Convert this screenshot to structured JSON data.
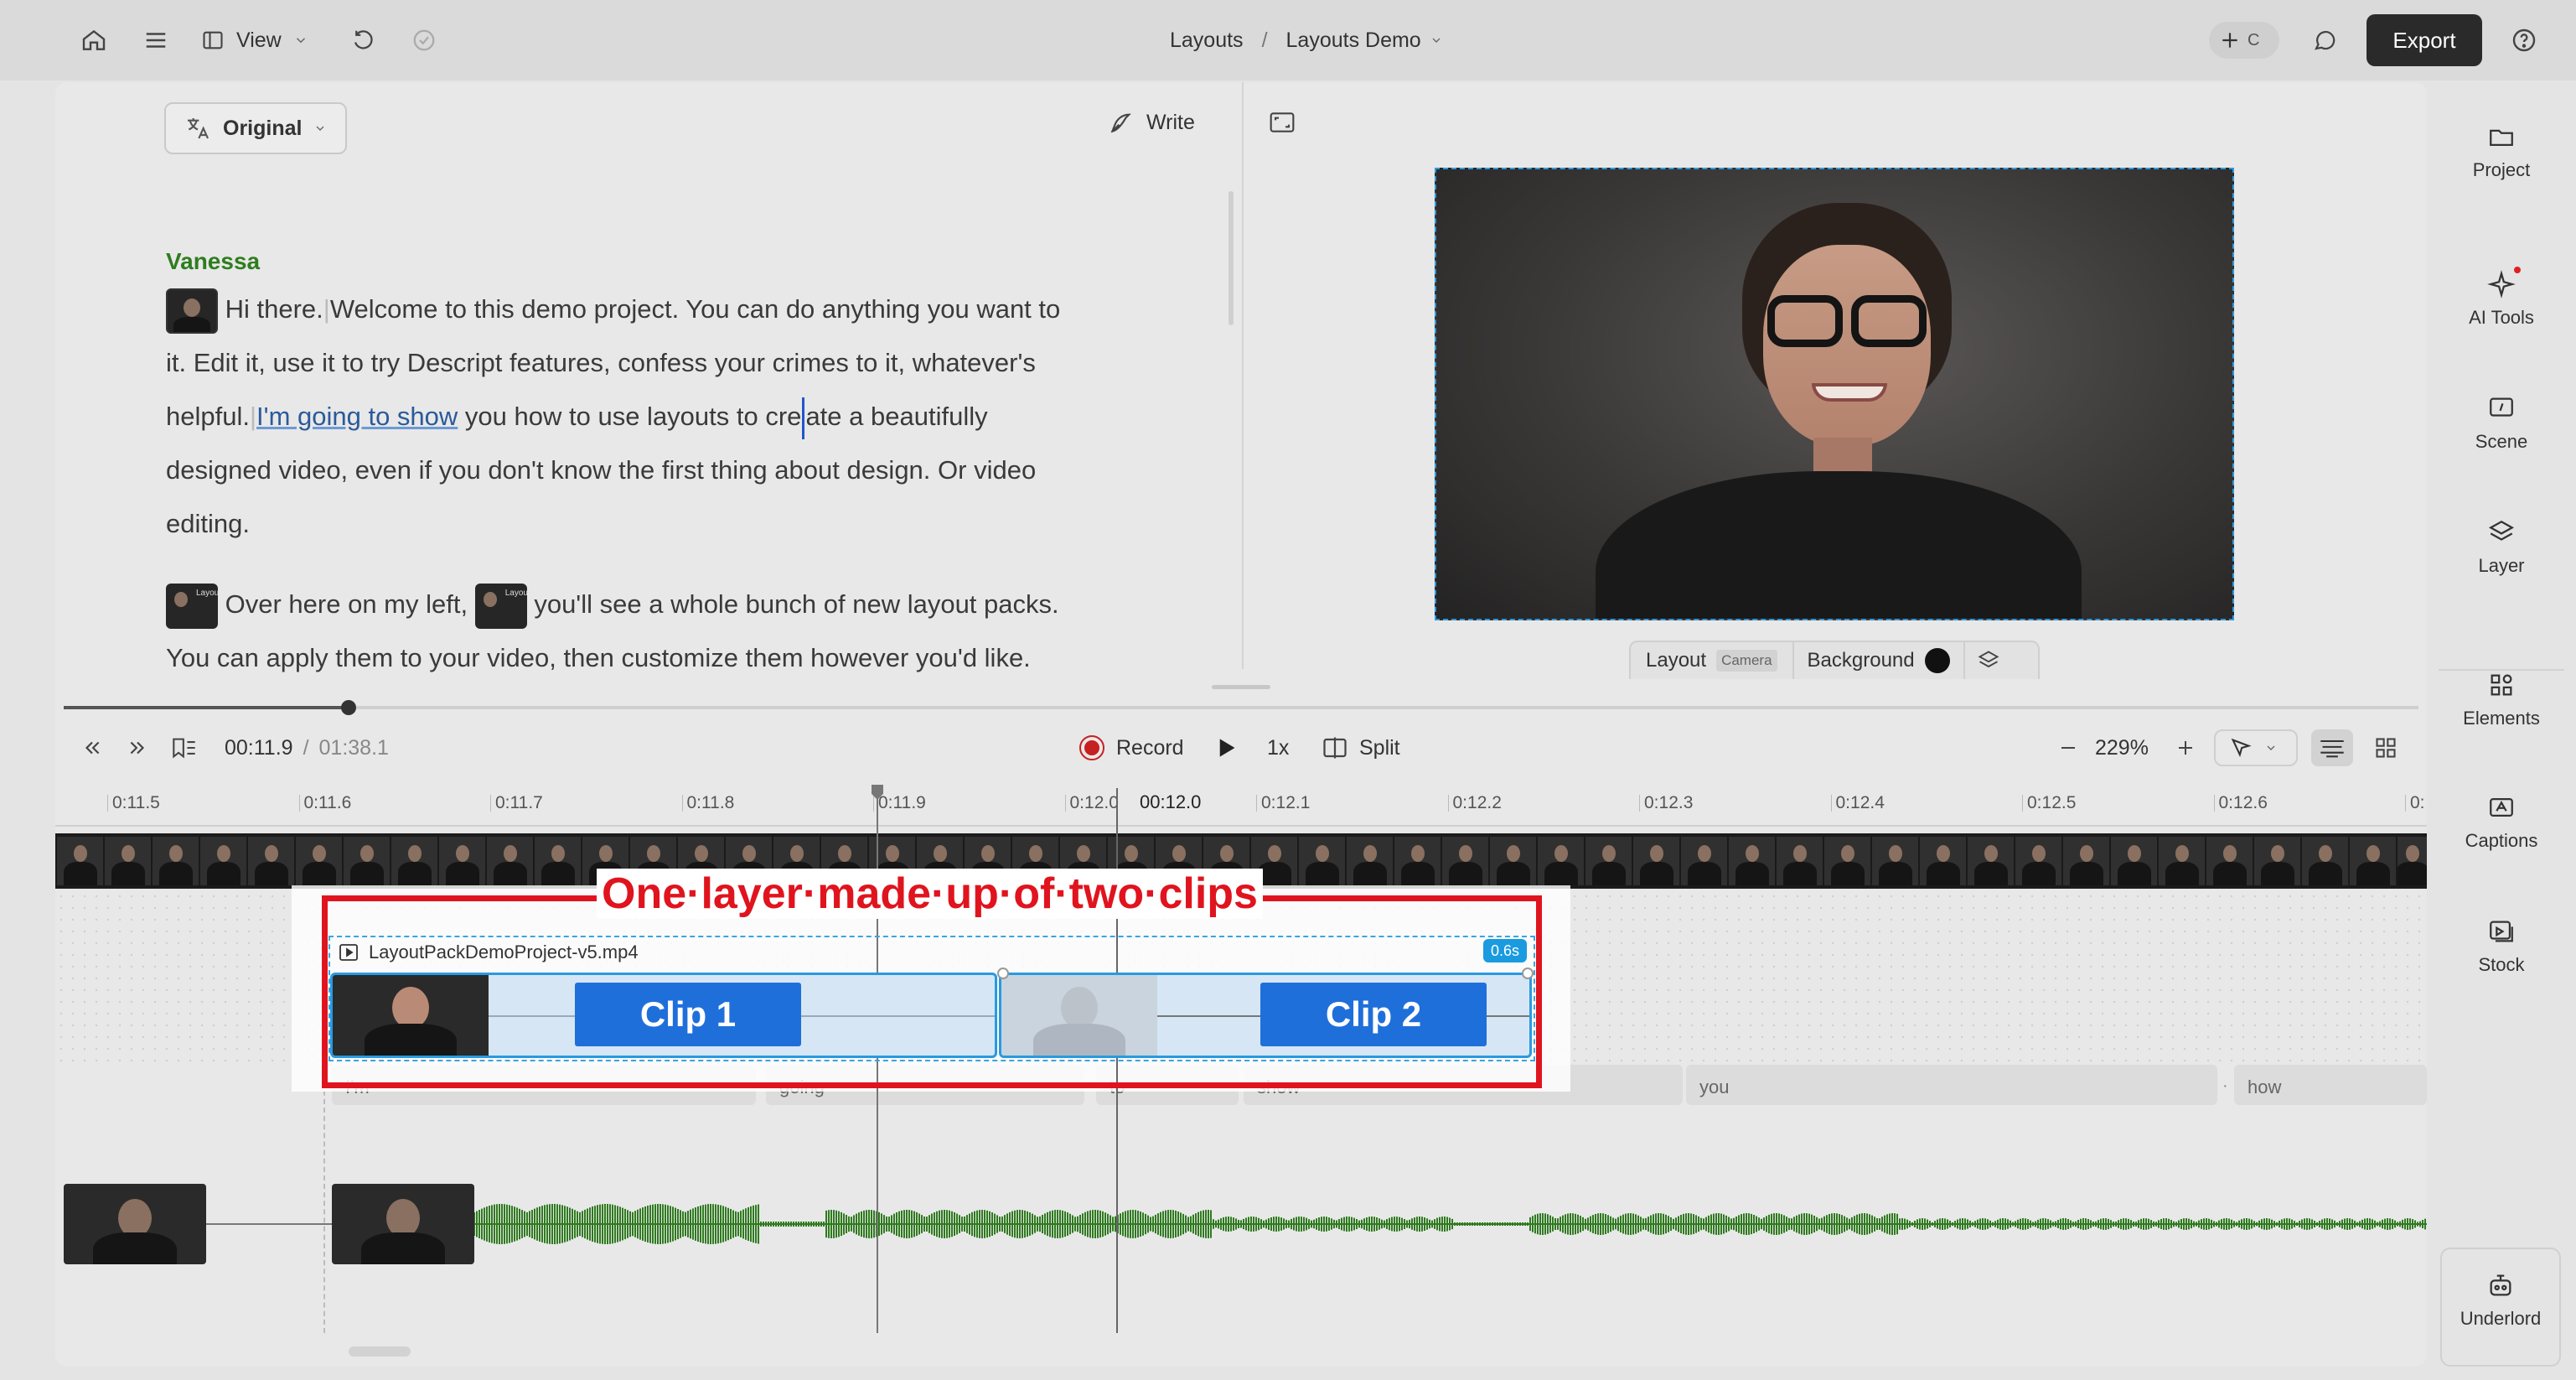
{
  "topbar": {
    "view_label": "View",
    "breadcrumb_root": "Layouts",
    "breadcrumb_sep": "/",
    "breadcrumb_current": "Layouts Demo",
    "add_collab_letter": "C",
    "export_label": "Export"
  },
  "script_panel": {
    "language_label": "Original",
    "write_label": "Write",
    "speaker": "Vanessa",
    "para1_a": "Hi there.",
    "para1_b": "Welcome to this demo project. You can do anything you want to",
    "para1_line2": "it. Edit it, use it to try Descript features, confess your crimes to it, whatever's",
    "para1_line3_a": "helpful.",
    "para1_line3_link": "I'm going to show",
    "para1_line3_b": "you how to use layouts to cre",
    "para1_line3_c": "ate a beautifully",
    "para1_line4": "designed video, even if you don't know the first thing about design. Or video",
    "para1_line5": "editing.",
    "para2_a": "Over here on my left,",
    "para2_b": "you'll see a whole bunch of new layout packs.",
    "para2_line2": "You can apply them to your video, then customize them however you'd like.",
    "thumb_text": "Layout packs"
  },
  "preview": {
    "layout_label": "Layout",
    "layout_value": "Camera",
    "background_label": "Background",
    "background_color": "#111111"
  },
  "transport": {
    "current_time": "00:11.9",
    "time_sep": "/",
    "total_time": "01:38.1",
    "record_label": "Record",
    "speed_label": "1x",
    "split_label": "Split",
    "zoom_label": "229%",
    "progress_fraction": 0.121
  },
  "ruler": {
    "ticks": [
      "0:11.5",
      "0:11.6",
      "0:11.7",
      "0:11.8",
      "0:11.9",
      "0:12.0",
      "0:12.1",
      "0:12.2",
      "0:12.3",
      "0:12.4",
      "0:12.5",
      "0:12.6",
      "0:"
    ],
    "playhead_label": "00:12.0"
  },
  "layer": {
    "annotation": "One·layer·made·up·of·two·clips",
    "file_name": "LayoutPackDemoProject-v5.mp4",
    "duration_badge": "0.6s",
    "clip1_label": "Clip 1",
    "clip2_label": "Clip 2"
  },
  "words": [
    "I'm",
    "going",
    "to",
    "show",
    "you",
    "how"
  ],
  "word_sep": "·",
  "right_rail": [
    {
      "label": "Project",
      "icon": "folder-icon"
    },
    {
      "label": "AI Tools",
      "icon": "sparkle-icon"
    },
    {
      "label": "Scene",
      "icon": "scene-icon"
    },
    {
      "label": "Layer",
      "icon": "layers-icon"
    },
    {
      "label": "Elements",
      "icon": "elements-icon"
    },
    {
      "label": "Captions",
      "icon": "captions-icon"
    },
    {
      "label": "Stock",
      "icon": "stock-icon"
    },
    {
      "label": "Underlord",
      "icon": "robot-icon"
    }
  ],
  "colors": {
    "accent": "#1a73d9",
    "annotation_red": "#e0141e",
    "speaker_green": "#2e7d1e",
    "waveform_green": "#2f7a1f",
    "badge_blue": "#1a9be0"
  }
}
